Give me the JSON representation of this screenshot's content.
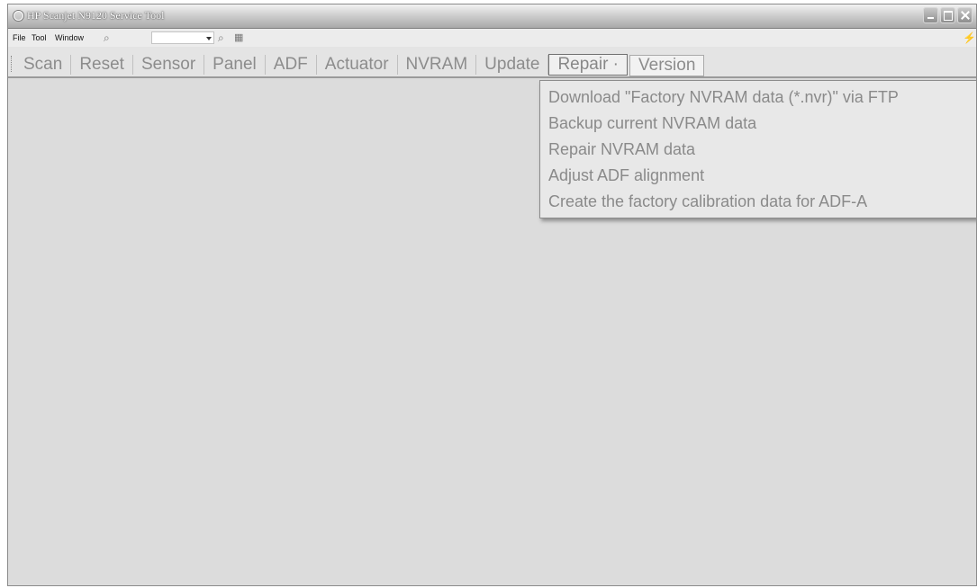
{
  "window": {
    "title": "HP Scanjet N9120 Service Tool"
  },
  "menubar": {
    "items": [
      "File",
      "Tool",
      "Window"
    ],
    "zoom_value": ""
  },
  "toolbar": {
    "tabs": [
      "Scan",
      "Reset",
      "Sensor",
      "Panel",
      "ADF",
      "Actuator",
      "NVRAM",
      "Update",
      "Repair ·",
      "Version"
    ],
    "active_tab": "Repair"
  },
  "repair_menu": {
    "items": [
      "Download \"Factory NVRAM data (*.nvr)\" via FTP",
      "Backup current NVRAM data",
      "Repair NVRAM data",
      "Adjust ADF alignment",
      "Create the factory calibration data for ADF-A"
    ]
  },
  "icons": {
    "app": "scanner-app-icon",
    "search": "magnifier-icon",
    "lightning": "lightning-icon"
  },
  "colors": {
    "workspace": "#dcdcdc",
    "text_disabled": "#8a8a8a"
  }
}
